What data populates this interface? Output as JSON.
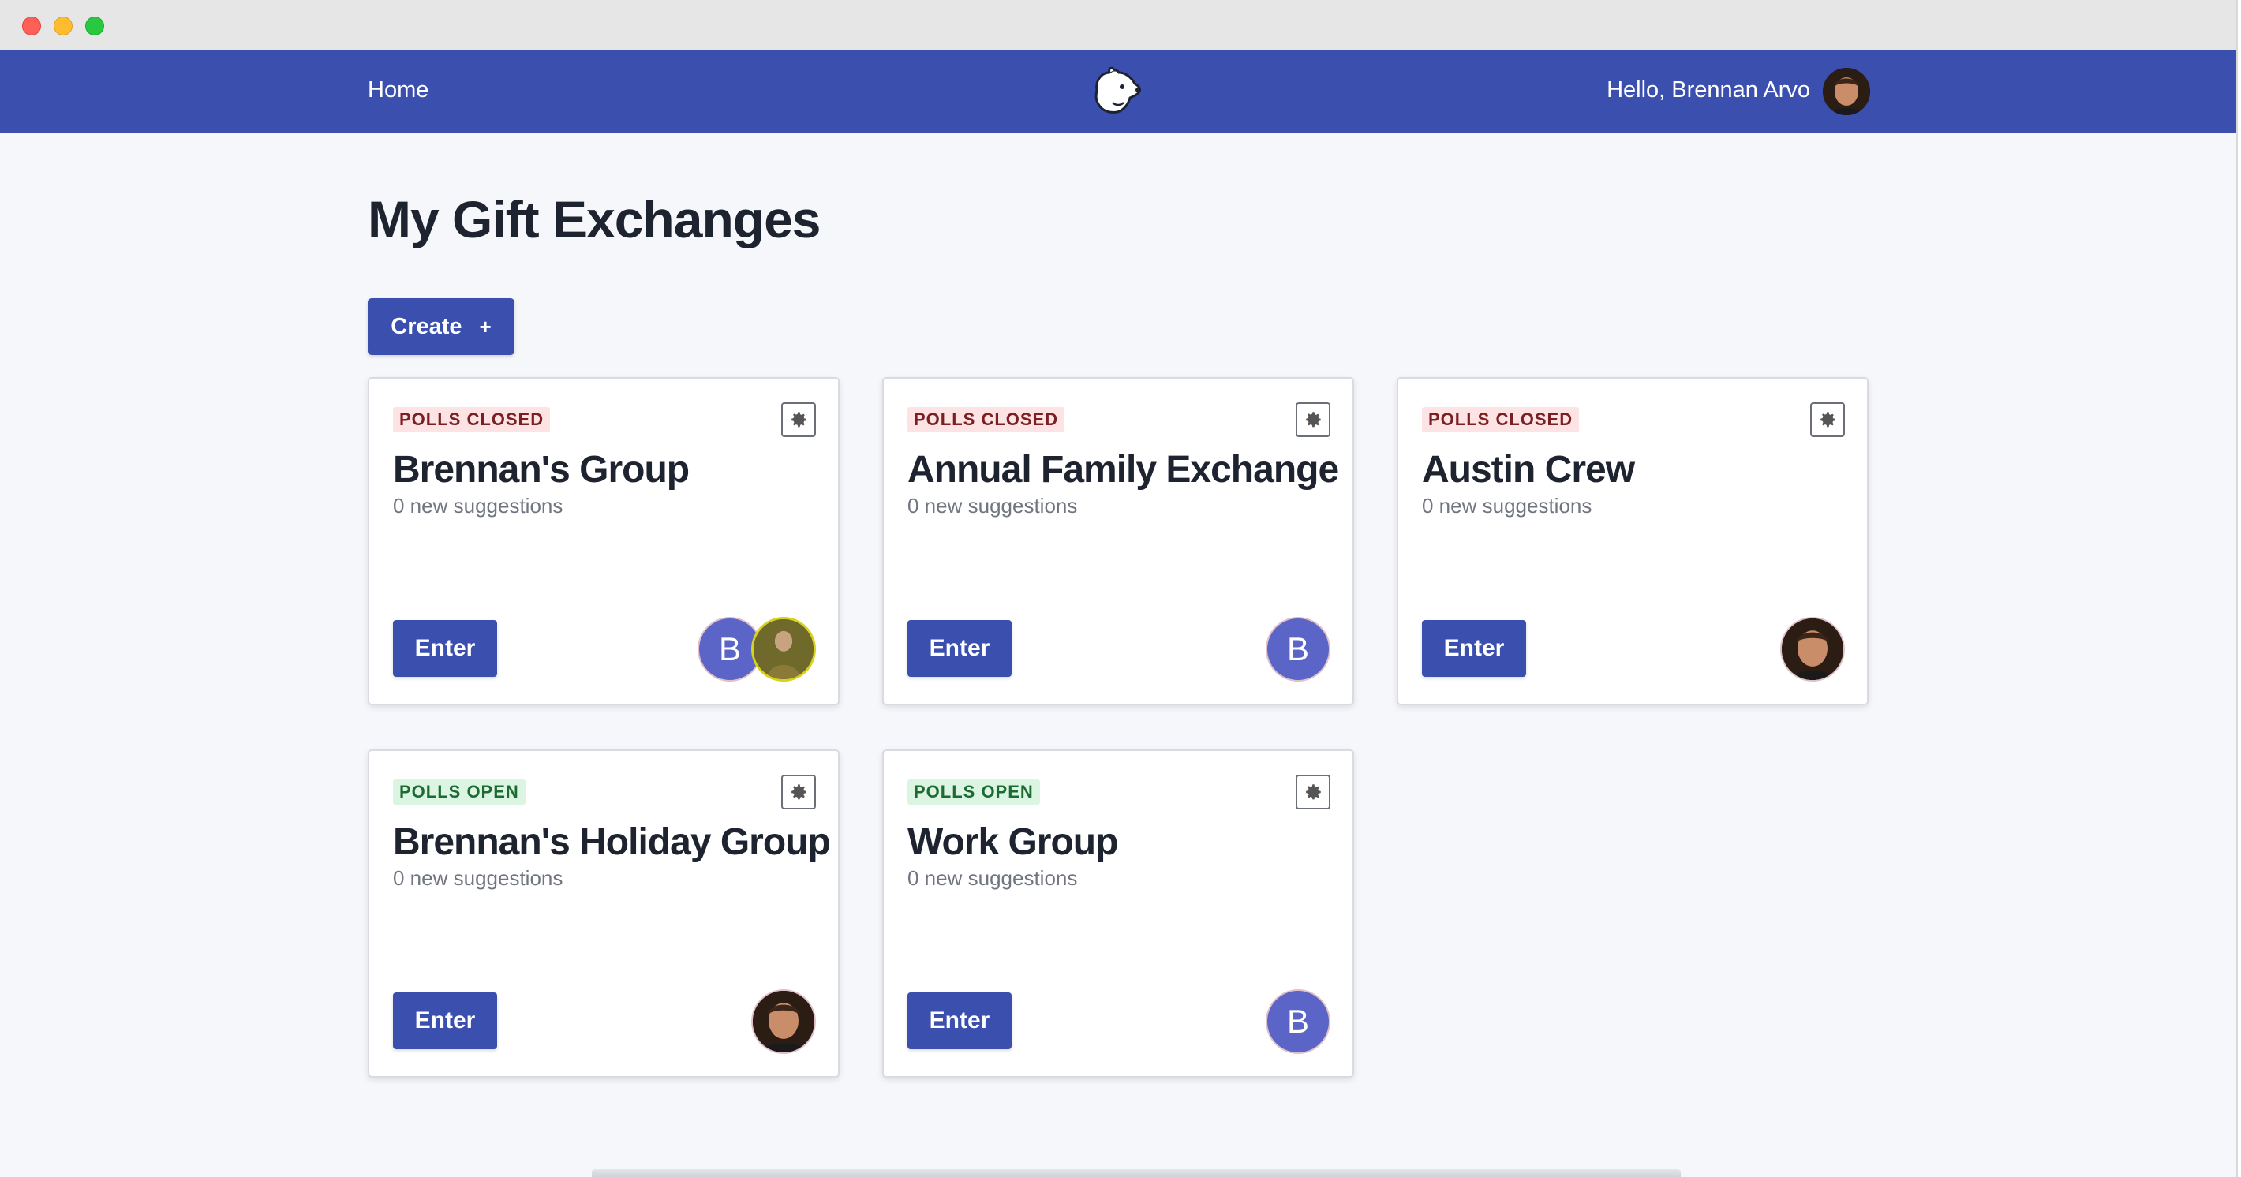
{
  "window": {
    "controls": [
      "close",
      "minimize",
      "zoom"
    ]
  },
  "navbar": {
    "home_label": "Home",
    "logo_icon": "polar-bear-icon",
    "greeting": "Hello, Brennan Arvo",
    "avatar": "user-avatar-photo"
  },
  "page": {
    "title": "My Gift Exchanges",
    "create_label": "Create",
    "create_icon": "+"
  },
  "colors": {
    "primary": "#3a4fae",
    "background": "#f6f7fb",
    "closed_badge_bg": "#fde3e3",
    "open_badge_bg": "#dcf5e2",
    "letter_avatar": "#5b65c7"
  },
  "cards": [
    {
      "status": "POLLS CLOSED",
      "status_type": "closed",
      "title": "Brennan's Group",
      "subtitle": "0 new suggestions",
      "enter_label": "Enter",
      "members": [
        "B",
        "photo"
      ]
    },
    {
      "status": "POLLS CLOSED",
      "status_type": "closed",
      "title": "Annual Family Exchange",
      "subtitle": "0 new suggestions",
      "enter_label": "Enter",
      "members": [
        "B"
      ]
    },
    {
      "status": "POLLS CLOSED",
      "status_type": "closed",
      "title": "Austin Crew",
      "subtitle": "0 new suggestions",
      "enter_label": "Enter",
      "members": [
        "photo"
      ]
    },
    {
      "status": "POLLS OPEN",
      "status_type": "open",
      "title": "Brennan's Holiday Group",
      "subtitle": "0 new suggestions",
      "enter_label": "Enter",
      "members": [
        "photo"
      ]
    },
    {
      "status": "POLLS OPEN",
      "status_type": "open",
      "title": "Work Group",
      "subtitle": "0 new suggestions",
      "enter_label": "Enter",
      "members": [
        "B"
      ]
    }
  ]
}
